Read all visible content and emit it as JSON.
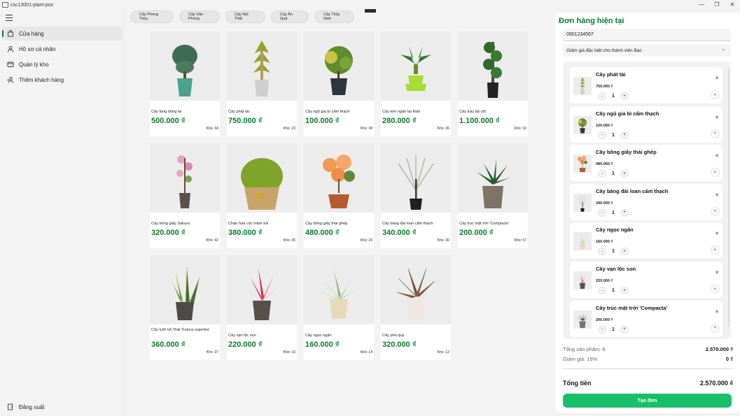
{
  "window": {
    "title": "csc13001-plant-pos",
    "controls": [
      "—",
      "❐",
      "✕"
    ]
  },
  "sidebar": {
    "items": [
      {
        "label": "Cửa hàng",
        "icon": "store-icon",
        "active": true
      },
      {
        "label": "Hồ sơ cá nhân",
        "icon": "person-icon"
      },
      {
        "label": "Quản lý kho",
        "icon": "inventory-icon"
      },
      {
        "label": "Thêm khách hàng",
        "icon": "add-person-icon"
      }
    ],
    "logout": "Đăng xuất"
  },
  "categories": [
    "Cây Phong Thủy",
    "Cây Văn Phòng",
    "Cây Nội Thất",
    "Cây Ăn Quả",
    "Cây Thủy Sinh"
  ],
  "products": [
    {
      "name": "Cây tùng bồng lai",
      "price": "500.000 ₫",
      "stock": "Kho: 34"
    },
    {
      "name": "Cây phát tài",
      "price": "750.000 ₫",
      "stock": "Kho: 23"
    },
    {
      "name": "Cây ngũ gia bì cẩm thạch",
      "price": "100.000 ₫",
      "stock": "Kho: 38"
    },
    {
      "name": "Cây kim ngân ba thân",
      "price": "280.000 ₫",
      "stock": "Kho: 36"
    },
    {
      "name": "Cây trầu bà cột",
      "price": "1.100.000 ₫",
      "stock": "Kho: 10"
    },
    {
      "name": "Cây bông giấy Sakura",
      "price": "320.000 ₫",
      "stock": "Kho: 42"
    },
    {
      "name": "Chậu hoa cúc mâm xôi",
      "price": "380.000 ₫",
      "stock": "Kho: 26"
    },
    {
      "name": "Cây bông giấy thái ghép",
      "price": "480.000 ₫",
      "stock": "Kho: 29"
    },
    {
      "name": "Cây bàng đài loan cẩm thạch",
      "price": "340.000 ₫",
      "stock": "Kho: 30"
    },
    {
      "name": "Cây trúc mặt trời 'Compacta'",
      "price": "200.000 ₫",
      "stock": "Kho: 57"
    },
    {
      "name": "Cây lưỡi hổ Thái 'Futura superba'",
      "price": "360.000 ₫",
      "stock": "Kho: 37"
    },
    {
      "name": "Cây vạn lộc son",
      "price": "220.000 ₫",
      "stock": "Kho: 16"
    },
    {
      "name": "Cây ngọc ngân",
      "price": "160.000 ₫",
      "stock": "Kho: 14"
    },
    {
      "name": "Cây phú quý",
      "price": "320.000 ₫",
      "stock": "Kho: 12"
    }
  ],
  "order": {
    "title": "Đơn hàng hiện tại",
    "phone": "0901234567",
    "discount": "Giảm giá đặc biệt cho thành viên Bạc",
    "items": [
      {
        "name": "Cây phát tài",
        "price": "750.000 ₫",
        "qty": "1"
      },
      {
        "name": "Cây ngũ gia bì cẩm thạch",
        "price": "100.000 ₫",
        "qty": "1"
      },
      {
        "name": "Cây bông giấy thái ghép",
        "price": "480.000 ₫",
        "qty": "1"
      },
      {
        "name": "Cây bàng đài loan cẩm thạch",
        "price": "340.000 ₫",
        "qty": "1"
      },
      {
        "name": "Cây ngọc ngân",
        "price": "160.000 ₫",
        "qty": "1"
      },
      {
        "name": "Cây vạn lộc son",
        "price": "220.000 ₫",
        "qty": "1"
      },
      {
        "name": "Cây trúc mặt trời 'Compacta'",
        "price": "200.000 ₫",
        "qty": "1"
      }
    ],
    "summary": {
      "count_label": "Tổng sản phẩm: 8",
      "count_value": "2.570.000 ₫",
      "discount_label": "Giảm giá: 15%",
      "discount_value": "0 ₫",
      "total_label": "Tổng tiền",
      "total_value": "2.570.000 ₫"
    },
    "submit": "Tạo đơn"
  },
  "colors": {
    "accent": "#0b7a2c",
    "button": "#18bf6a"
  }
}
